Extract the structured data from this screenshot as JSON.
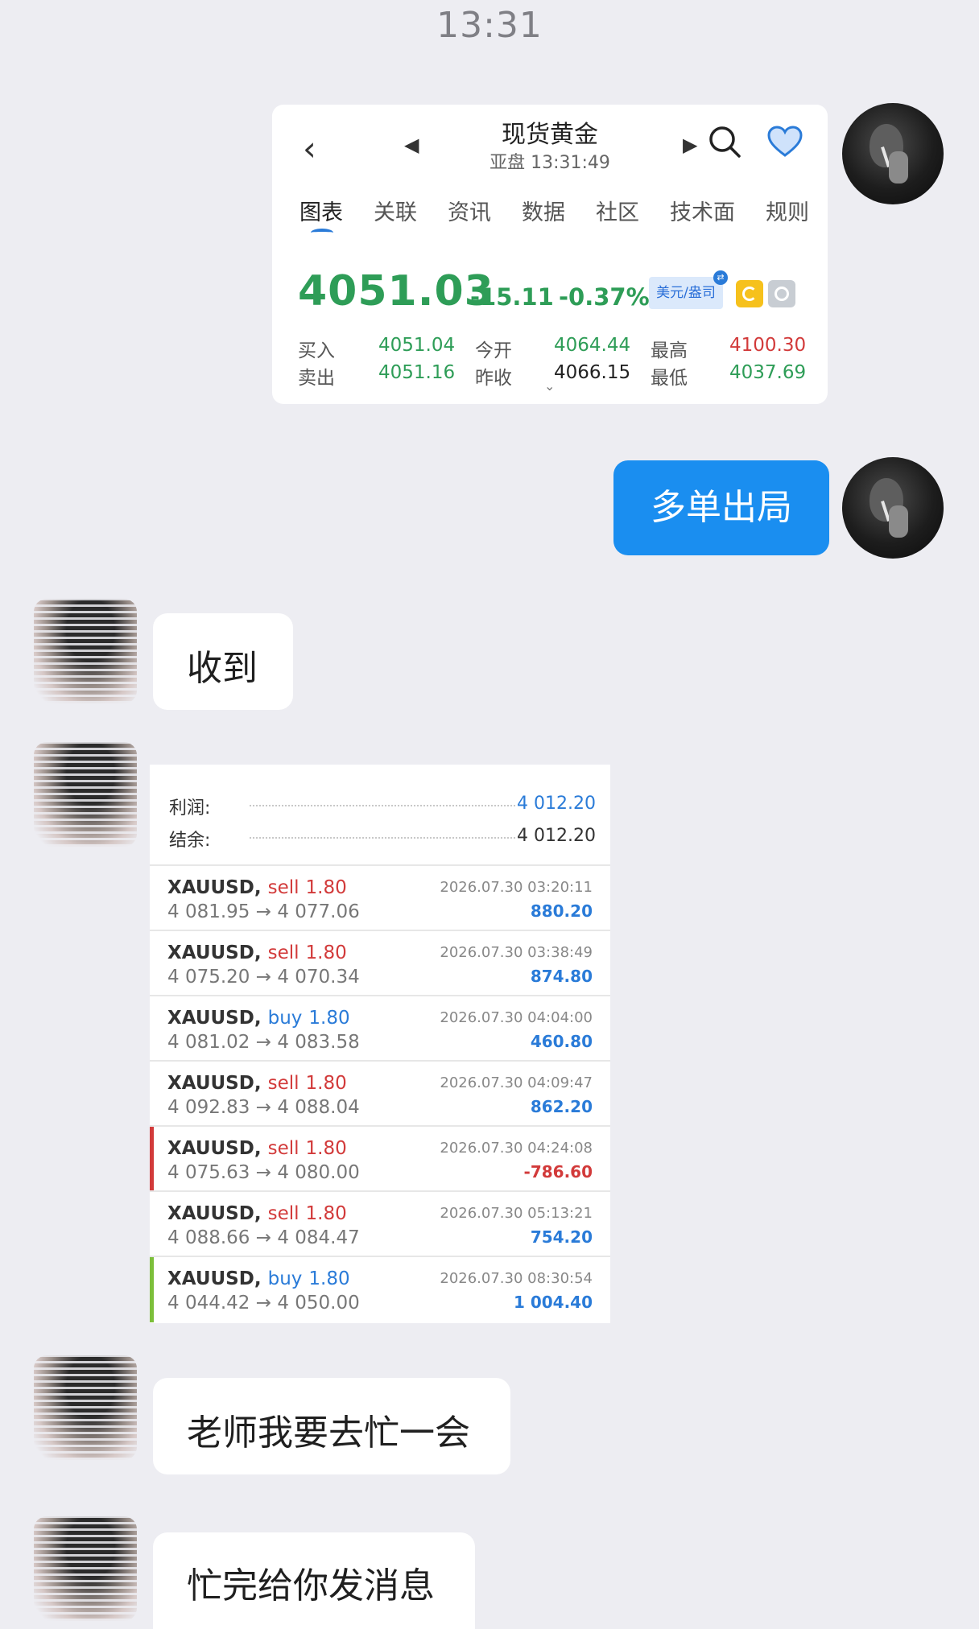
{
  "status_bar": {
    "time": "13:31"
  },
  "quote_card": {
    "back_icon": "back-arrow-icon",
    "title": "现货黄金",
    "subtitle": "亚盘  13:31:49",
    "tabs": [
      "图表",
      "关联",
      "资讯",
      "数据",
      "社区",
      "技术面",
      "规则"
    ],
    "active_tab": "图表",
    "price": "4051.03",
    "change": "-15.11",
    "change_pct": "-0.37%",
    "currency": "美元/盎司",
    "stats": {
      "buy_label": "买入",
      "buy": "4051.04",
      "sell_label": "卖出",
      "sell": "4051.16",
      "open_label": "今开",
      "open": "4064.44",
      "prev_close_label": "昨收",
      "prev_close": "4066.15",
      "high_label": "最高",
      "high": "4100.30",
      "low_label": "最低",
      "low": "4037.69"
    },
    "colors": {
      "up": "#2e9d57",
      "down": "#d23a3a",
      "accent": "#2a7bd8"
    }
  },
  "messages": {
    "outgoing_1": "多单出局",
    "incoming_1": "收到",
    "incoming_2": "老师我要去忙一会",
    "incoming_3": "忙完给你发消息"
  },
  "trades_card": {
    "profit_label": "利润:",
    "profit_value": "4 012.20",
    "balance_label": "结余:",
    "balance_value": "4 012.20",
    "rows": [
      {
        "symbol": "XAUUSD,",
        "side": "sell",
        "lots": "1.80",
        "prices": "4 081.95 → 4 077.06",
        "time": "2026.07.30 03:20:11",
        "pl": "880.20",
        "flag": ""
      },
      {
        "symbol": "XAUUSD,",
        "side": "sell",
        "lots": "1.80",
        "prices": "4 075.20 → 4 070.34",
        "time": "2026.07.30 03:38:49",
        "pl": "874.80",
        "flag": ""
      },
      {
        "symbol": "XAUUSD,",
        "side": "buy",
        "lots": "1.80",
        "prices": "4 081.02 → 4 083.58",
        "time": "2026.07.30 04:04:00",
        "pl": "460.80",
        "flag": ""
      },
      {
        "symbol": "XAUUSD,",
        "side": "sell",
        "lots": "1.80",
        "prices": "4 092.83 → 4 088.04",
        "time": "2026.07.30 04:09:47",
        "pl": "862.20",
        "flag": ""
      },
      {
        "symbol": "XAUUSD,",
        "side": "sell",
        "lots": "1.80",
        "prices": "4 075.63 → 4 080.00",
        "time": "2026.07.30 04:24:08",
        "pl": "-786.60",
        "flag": "#d23a3a"
      },
      {
        "symbol": "XAUUSD,",
        "side": "sell",
        "lots": "1.80",
        "prices": "4 088.66 → 4 084.47",
        "time": "2026.07.30 05:13:21",
        "pl": "754.20",
        "flag": ""
      },
      {
        "symbol": "XAUUSD,",
        "side": "buy",
        "lots": "1.80",
        "prices": "4 044.42 → 4 050.00",
        "time": "2026.07.30 08:30:54",
        "pl": "1 004.40",
        "flag": "#7cbf3a"
      }
    ]
  }
}
